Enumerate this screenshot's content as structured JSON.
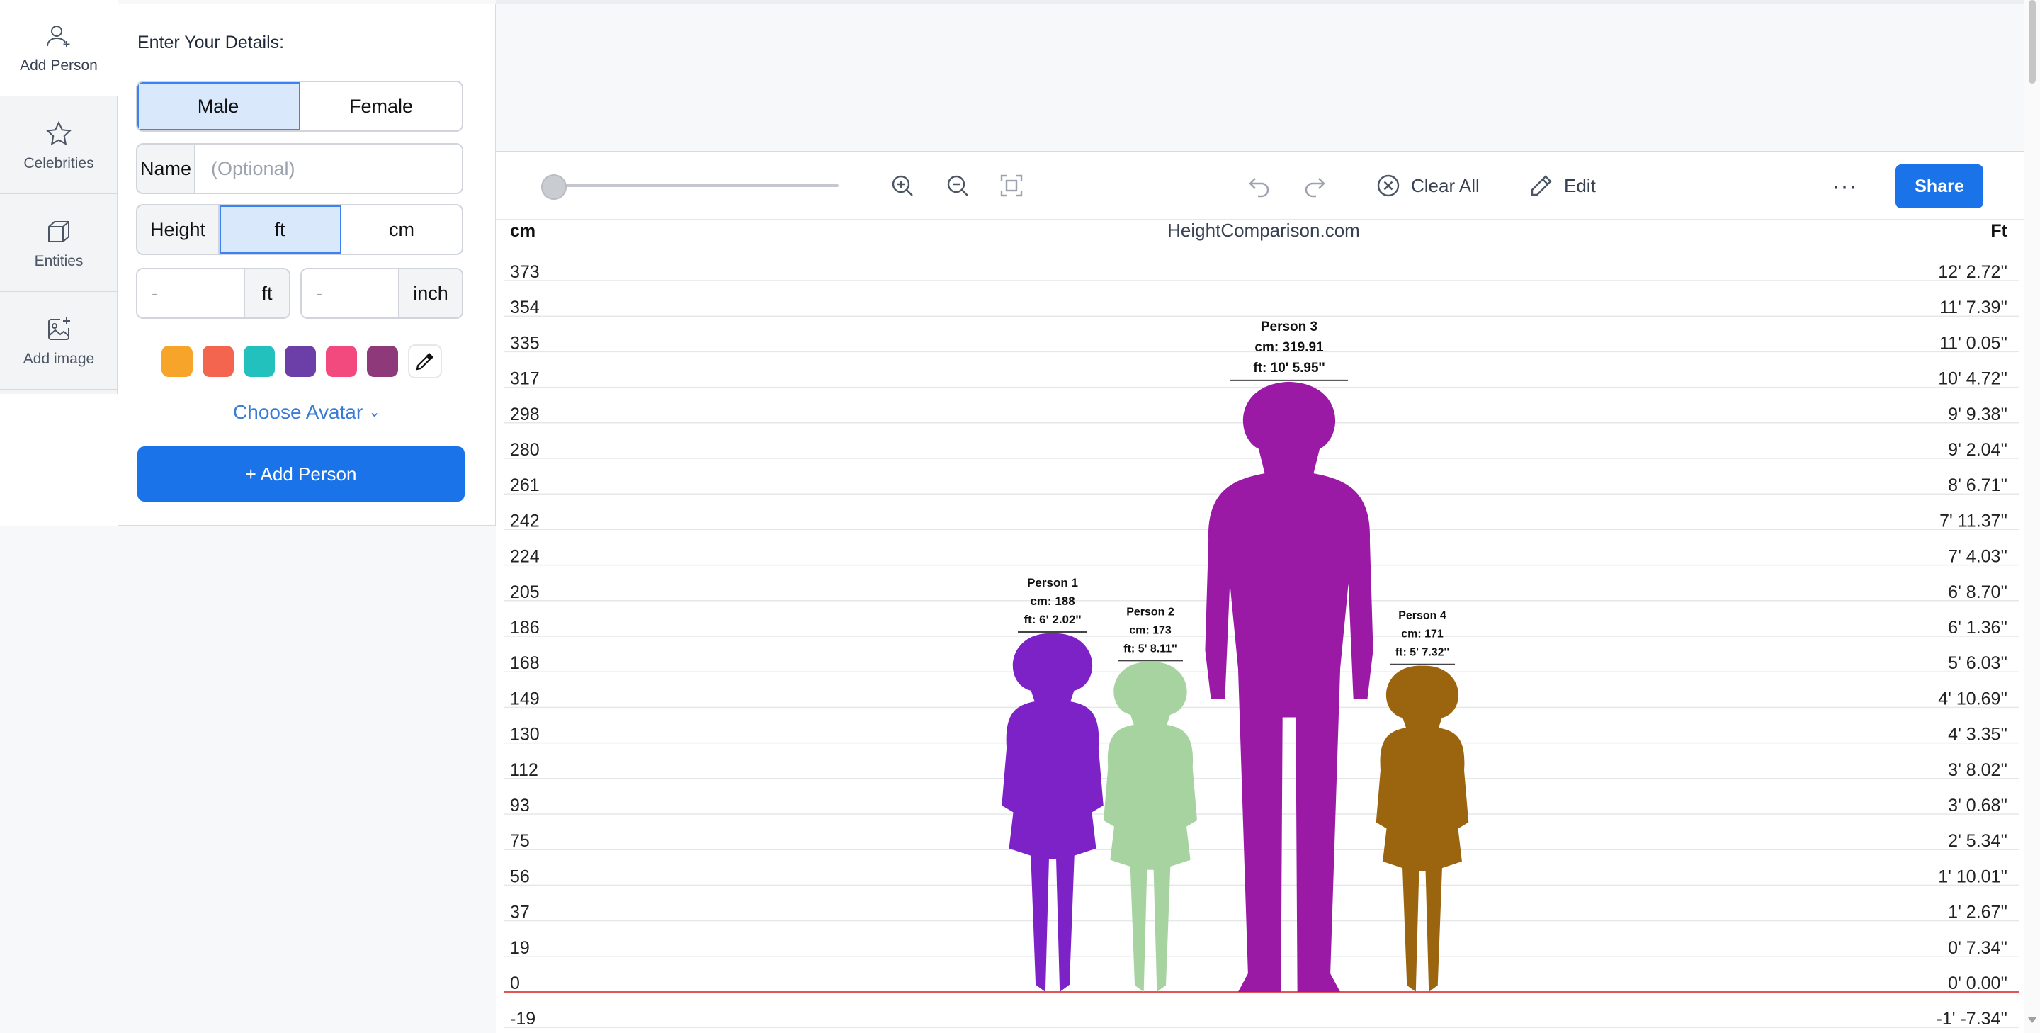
{
  "rail": {
    "items": [
      {
        "label": "Add Person",
        "icon": "user-plus-icon"
      },
      {
        "label": "Celebrities",
        "icon": "star-icon"
      },
      {
        "label": "Entities",
        "icon": "cube-icon"
      },
      {
        "label": "Add image",
        "icon": "image-plus-icon"
      }
    ]
  },
  "form": {
    "title": "Enter Your Details:",
    "gender": {
      "male": "Male",
      "female": "Female",
      "selected": "Male"
    },
    "name": {
      "label": "Name",
      "placeholder": "(Optional)",
      "value": ""
    },
    "height": {
      "label": "Height",
      "unit_ft": "ft",
      "unit_cm": "cm",
      "selected": "ft"
    },
    "feet": {
      "placeholder": "-",
      "unit": "ft"
    },
    "inch": {
      "placeholder": "-",
      "unit": "inch"
    },
    "colors": [
      "#f7a42b",
      "#f4654f",
      "#22c1bd",
      "#6b3ea8",
      "#f2497f",
      "#8e3a7a"
    ],
    "choose_avatar": "Choose Avatar",
    "add_button": "+ Add Person"
  },
  "toolbar": {
    "zoom_slider_value": 0,
    "clear_all": "Clear All",
    "edit": "Edit",
    "more": "···",
    "share": "Share"
  },
  "chart_data": {
    "type": "height-comparison",
    "title": "HeightComparison.com",
    "left_axis_label": "cm",
    "right_axis_label": "Ft",
    "cm_ticks": [
      "373",
      "354",
      "335",
      "317",
      "298",
      "280",
      "261",
      "242",
      "224",
      "205",
      "186",
      "168",
      "149",
      "130",
      "112",
      "93",
      "75",
      "56",
      "37",
      "19",
      "0",
      "-19"
    ],
    "ft_ticks": [
      "12' 2.72''",
      "11' 7.39''",
      "11' 0.05''",
      "10' 4.72''",
      "9' 9.38''",
      "9' 2.04''",
      "8' 6.71''",
      "7' 11.37''",
      "7' 4.03''",
      "6' 8.70''",
      "6' 1.36''",
      "5' 6.03''",
      "4' 10.69''",
      "4' 3.35''",
      "3' 8.02''",
      "3' 0.68''",
      "2' 5.34''",
      "1' 10.01''",
      "1' 2.67''",
      "0' 7.34''",
      "0' 0.00''",
      "-1' -7.34''"
    ],
    "persons": [
      {
        "name": "Person 1",
        "cm": 188,
        "cm_label": "cm: 188",
        "ft_label": "ft: 6' 2.02''",
        "color": "#7d22c6",
        "gender": "female"
      },
      {
        "name": "Person 2",
        "cm": 173,
        "cm_label": "cm: 173",
        "ft_label": "ft: 5' 8.11''",
        "color": "#a7d3a0",
        "gender": "female"
      },
      {
        "name": "Person 3",
        "cm": 319.91,
        "cm_label": "cm: 319.91",
        "ft_label": "ft: 10' 5.95''",
        "color": "#9a1aa6",
        "gender": "male"
      },
      {
        "name": "Person 4",
        "cm": 171,
        "cm_label": "cm: 171",
        "ft_label": "ft: 5' 7.32''",
        "color": "#9b6510",
        "gender": "female"
      }
    ]
  }
}
